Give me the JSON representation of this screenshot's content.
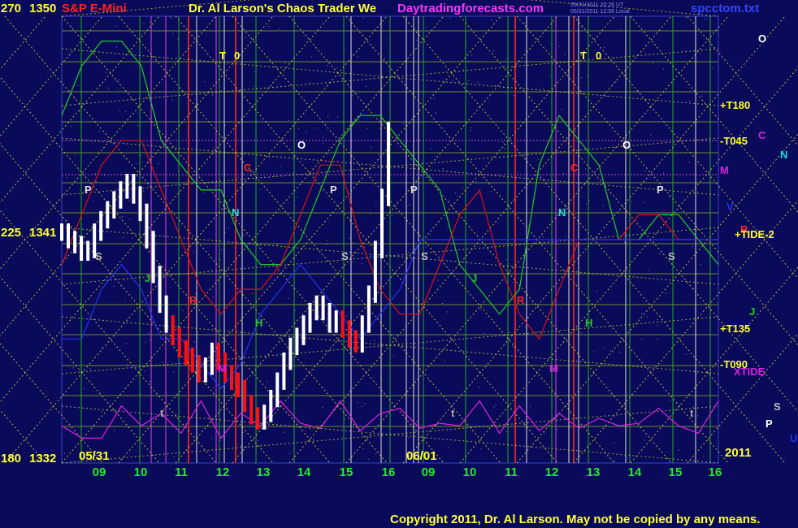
{
  "header": {
    "scale_top": "270",
    "price_top": "1350",
    "instrument": "S&P E-Mini",
    "title": "Dr. Al Larson's Chaos Trader We",
    "site": "Daytradingforecasts.com",
    "stamp_line1": "05/31/2011 20:26 UT",
    "stamp_line2": "05/31/2011 12:56 Local",
    "file": "spcctom.txt"
  },
  "left_axis": {
    "mid_scale": "225",
    "mid_price": "1341",
    "bottom_scale": "180",
    "bottom_price": "1332"
  },
  "footer": {
    "copyright": "Copyright 2011, Dr. Al Larson. May not be copied by any means.",
    "year": "2011"
  },
  "chart_data": {
    "type": "line",
    "y_range": [
      1332,
      1350
    ],
    "x_ticks": [
      "09",
      "10",
      "11",
      "12",
      "13",
      "14",
      "15",
      "16",
      "09",
      "10",
      "11",
      "12",
      "13",
      "14",
      "15",
      "16"
    ],
    "date_labels": [
      "05/31",
      "06/01"
    ],
    "colors": {
      "background": "#0a0a5a",
      "price_bars": "#ffffff",
      "price_bars_down": "#ff1010",
      "green_line": "#22cc22",
      "red_line": "#dd1111",
      "blue_line": "#2233ee",
      "magenta_line": "#dd22dd",
      "yellow_grid": "#dddd33",
      "vertical_green": "#22aa22",
      "vertical_red": "#cc2222",
      "vertical_white": "#dddddd"
    },
    "price_bars": [
      1341.3,
      1341.0,
      1340.8,
      1340.5,
      1340.6,
      1341.3,
      1341.8,
      1342.2,
      1342.6,
      1343.0,
      1343.3,
      1342.8,
      1342.1,
      1341.0,
      1339.6,
      1338.4,
      1337.6,
      1337.1,
      1336.6,
      1336.3,
      1336.0,
      1335.6,
      1335.9,
      1336.5,
      1336.1,
      1335.6,
      1335.3,
      1335.0,
      1334.4,
      1333.9,
      1333.7,
      1334.0,
      1334.6,
      1335.3,
      1336.1,
      1336.7,
      1337.1,
      1337.6,
      1338.1,
      1338.4,
      1338.1,
      1337.6,
      1337.8,
      1337.4,
      1337.0,
      1336.8,
      1337.6,
      1338.8,
      1340.6,
      1342.7,
      1345.4
    ],
    "series": [
      {
        "color": "#22cc22",
        "values": [
          1346,
          1348,
          1349,
          1349,
          1348,
          1345,
          1344,
          1343,
          1343,
          1341,
          1340,
          1340,
          1341,
          1343,
          1345,
          1346,
          1346,
          1345,
          1344,
          1343,
          1340,
          1339,
          1338,
          1339,
          1344,
          1346,
          1345,
          1344,
          1341,
          1341,
          1342,
          1342,
          1341,
          1340
        ]
      },
      {
        "color": "#dd1111",
        "values": [
          1340,
          1342,
          1344,
          1345,
          1345,
          1343,
          1341,
          1339,
          1338,
          1339,
          1339,
          1340,
          1342,
          1344,
          1344,
          1341,
          1339,
          1338,
          1338,
          1340,
          1342,
          1343,
          1340,
          1338,
          1337,
          1339,
          1341,
          1341,
          1341,
          1342,
          1342,
          1341,
          1341,
          1341
        ]
      },
      {
        "color": "#2233ee",
        "values": [
          1337,
          1337,
          1339,
          1340,
          1339,
          1337,
          1337,
          1336,
          1335,
          1336,
          1338,
          1339,
          1340,
          1339,
          1338,
          1337,
          1338,
          1339,
          1341,
          1341,
          1341,
          1341,
          1341,
          1341,
          1341,
          1341,
          1341,
          1341,
          1341,
          1341,
          1341,
          1341,
          1341,
          1341
        ]
      },
      {
        "color": "#dd22dd",
        "values": [
          1333.5,
          1333,
          1333,
          1334.3,
          1333.5,
          1334,
          1333.2,
          1334.5,
          1333,
          1334,
          1333.5,
          1334.5,
          1333.6,
          1333.4,
          1334.5,
          1333.3,
          1334,
          1334.2,
          1333.4,
          1333.6,
          1333.5,
          1334.5,
          1333.2,
          1334.3,
          1333.3,
          1334,
          1333.4,
          1333.8,
          1333.5,
          1333.6,
          1334.2,
          1333.5,
          1333.2,
          1334.5
        ]
      }
    ],
    "grid_h": true,
    "grid_v": true
  },
  "markers": [
    {
      "t": "T",
      "c": "#ffff33"
    },
    {
      "t": "0",
      "c": "#ffff33"
    },
    {
      "t": "T",
      "c": "#ffff33"
    },
    {
      "t": "0",
      "c": "#ffff33"
    },
    {
      "t": "O",
      "c": "#ffffff"
    },
    {
      "t": "O",
      "c": "#ffffff"
    },
    {
      "t": "C",
      "c": "#ff2222"
    },
    {
      "t": "C",
      "c": "#ff2222"
    },
    {
      "t": "P",
      "c": "#dddddd"
    },
    {
      "t": "P",
      "c": "#dddddd"
    },
    {
      "t": "P",
      "c": "#dddddd"
    },
    {
      "t": "P",
      "c": "#dddddd"
    },
    {
      "t": "N",
      "c": "#22dddd"
    },
    {
      "t": "N",
      "c": "#22dddd"
    },
    {
      "t": "S",
      "c": "#bbbbbb"
    },
    {
      "t": "S",
      "c": "#bbbbbb"
    },
    {
      "t": "S",
      "c": "#bbbbbb"
    },
    {
      "t": "S",
      "c": "#bbbbbb"
    },
    {
      "t": "J",
      "c": "#22cc22"
    },
    {
      "t": "J",
      "c": "#22cc22"
    },
    {
      "t": "R",
      "c": "#ff2222"
    },
    {
      "t": "R",
      "c": "#ff2222"
    },
    {
      "t": "H",
      "c": "#22cc22"
    },
    {
      "t": "H",
      "c": "#22cc22"
    },
    {
      "t": "M",
      "c": "#dd22dd"
    },
    {
      "t": "M",
      "c": "#dd22dd"
    },
    {
      "t": "t",
      "c": "#aaaaaa"
    },
    {
      "t": "t",
      "c": "#aaaaaa"
    },
    {
      "t": "t",
      "c": "#aaaaaa"
    }
  ],
  "right_labels": [
    {
      "t": "O",
      "c": "#ffffff"
    },
    {
      "t": "+T180",
      "c": "#ffff33"
    },
    {
      "t": "C",
      "c": "#dd22dd"
    },
    {
      "t": "N",
      "c": "#22dddd"
    },
    {
      "t": "-T045",
      "c": "#ffff33"
    },
    {
      "t": "M",
      "c": "#dd22dd"
    },
    {
      "t": "V",
      "c": "#2233ee"
    },
    {
      "t": "R",
      "c": "#ff2222"
    },
    {
      "t": "+TIDE-2",
      "c": "#ffff33"
    },
    {
      "t": "J",
      "c": "#22cc22"
    },
    {
      "t": "+T135",
      "c": "#ffff33"
    },
    {
      "t": "-T090",
      "c": "#ffff33"
    },
    {
      "t": "XTIDE",
      "c": "#dd22dd"
    },
    {
      "t": "S",
      "c": "#bbbbbb"
    },
    {
      "t": "P",
      "c": "#ffffff"
    },
    {
      "t": "U",
      "c": "#2233ee"
    }
  ]
}
